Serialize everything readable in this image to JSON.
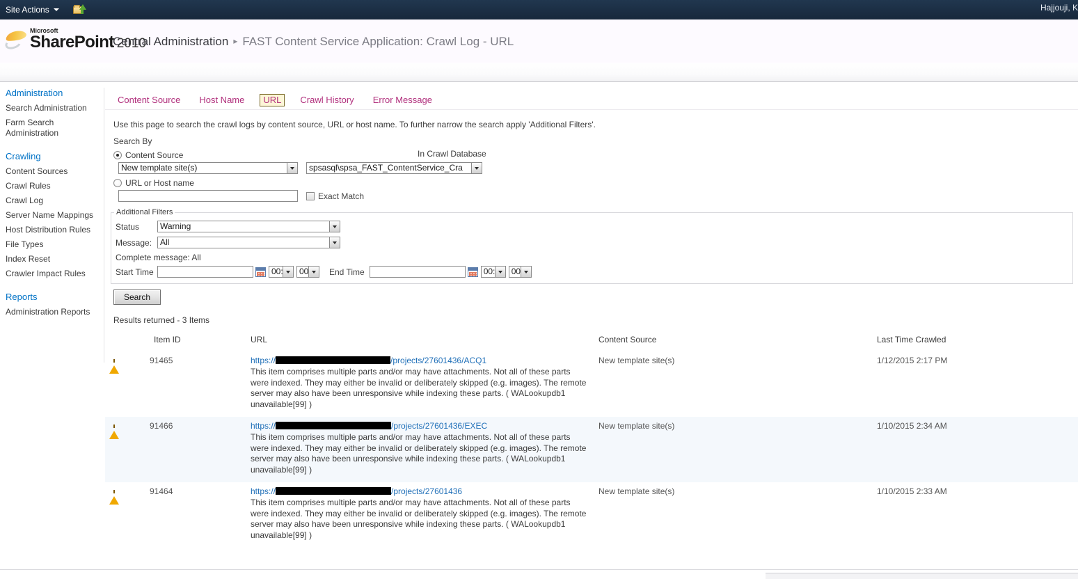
{
  "topbar": {
    "site_actions_label": "Site Actions",
    "nav_up_icon": "folder-navigate-up-icon",
    "user_name": "Hajjouji, K"
  },
  "header": {
    "logo_microsoft": "Microsoft",
    "logo_product": "SharePoint",
    "logo_year": "2010",
    "breadcrumb_root": "Central Administration",
    "breadcrumb_separator": "▸",
    "breadcrumb_current": "FAST Content Service Application: Crawl Log - URL"
  },
  "sidebar": {
    "groups": [
      {
        "heading": "Administration",
        "items": [
          {
            "label": "Search Administration"
          },
          {
            "label": "Farm Search Administration"
          }
        ]
      },
      {
        "heading": "Crawling",
        "items": [
          {
            "label": "Content Sources"
          },
          {
            "label": "Crawl Rules"
          },
          {
            "label": "Crawl Log"
          },
          {
            "label": "Server Name Mappings"
          },
          {
            "label": "Host Distribution Rules"
          },
          {
            "label": "File Types"
          },
          {
            "label": "Index Reset"
          },
          {
            "label": "Crawler Impact Rules"
          }
        ]
      },
      {
        "heading": "Reports",
        "items": [
          {
            "label": "Administration Reports"
          }
        ]
      }
    ]
  },
  "tabs": [
    {
      "label": "Content Source",
      "active": false
    },
    {
      "label": "Host Name",
      "active": false
    },
    {
      "label": "URL",
      "active": true
    },
    {
      "label": "Crawl History",
      "active": false
    },
    {
      "label": "Error Message",
      "active": false
    }
  ],
  "page": {
    "description": "Use this page to search the crawl logs by content source, URL or host name. To further narrow the search apply 'Additional Filters'."
  },
  "search_by": {
    "section_label": "Search By",
    "content_source_radio_label": "Content Source",
    "content_source_selected": true,
    "content_source_value": "New template site(s)",
    "in_crawl_database_label": "In Crawl Database",
    "in_crawl_database_value": "spsasql\\spsa_FAST_ContentService_Cra",
    "url_or_host_radio_label": "URL or Host name",
    "url_or_host_selected": false,
    "url_or_host_value": "",
    "exact_match_label": "Exact Match",
    "exact_match_checked": false
  },
  "additional_filters": {
    "legend": "Additional Filters",
    "status_label": "Status",
    "status_value": "Warning",
    "message_label": "Message:",
    "message_value": "All",
    "complete_message": "Complete message: All",
    "start_time_label": "Start Time",
    "start_time_value": "",
    "start_hour_value": "00:",
    "start_minute_value": "00",
    "end_time_label": "End Time",
    "end_time_value": "",
    "end_hour_value": "00:",
    "end_minute_value": "00",
    "calendar_icon": "calendar-icon"
  },
  "actions": {
    "search_button_label": "Search"
  },
  "results": {
    "count_text": "Results returned - 3 Items",
    "columns": {
      "status": "",
      "item_id": "Item ID",
      "url": "URL",
      "content_source": "Content Source",
      "last_time_crawled": "Last Time Crawled"
    },
    "rows": [
      {
        "status_icon": "warning-icon",
        "item_id": "91465",
        "url_prefix": "https://",
        "url_redacted_width": 165,
        "url_suffix": "/projects/27601436/ACQ1",
        "message": "This item comprises multiple parts and/or may have attachments. Not all of these parts were indexed. They may either be invalid or deliberately skipped (e.g. images). The remote server may also have been unresponsive while indexing these parts. ( WALookupdb1 unavailable[99] )",
        "content_source": "New template site(s)",
        "last_time_crawled": "1/12/2015 2:17 PM"
      },
      {
        "status_icon": "warning-icon",
        "item_id": "91466",
        "url_prefix": "https://",
        "url_redacted_width": 166,
        "url_suffix": "/projects/27601436/EXEC",
        "message": "This item comprises multiple parts and/or may have attachments. Not all of these parts were indexed. They may either be invalid or deliberately skipped (e.g. images). The remote server may also have been unresponsive while indexing these parts. ( WALookupdb1 unavailable[99] )",
        "content_source": "New template site(s)",
        "last_time_crawled": "1/10/2015 2:34 AM"
      },
      {
        "status_icon": "warning-icon",
        "item_id": "91464",
        "url_prefix": "https://",
        "url_redacted_width": 166,
        "url_suffix": "/projects/27601436",
        "message": "This item comprises multiple parts and/or may have attachments. Not all of these parts were indexed. They may either be invalid or deliberately skipped (e.g. images). The remote server may also have been unresponsive while indexing these parts. ( WALookupdb1 unavailable[99] )",
        "content_source": "New template site(s)",
        "last_time_crawled": "1/10/2015 2:33 AM"
      }
    ]
  },
  "colors": {
    "topbar": "#1c2f45",
    "tab_text": "#b1307d",
    "tab_active_bg": "#fdf6d8",
    "link": "#1f6fb8",
    "nav_heading": "#0072c6",
    "warning": "#f0a800",
    "alt_row_bg": "#f4f8fc"
  }
}
